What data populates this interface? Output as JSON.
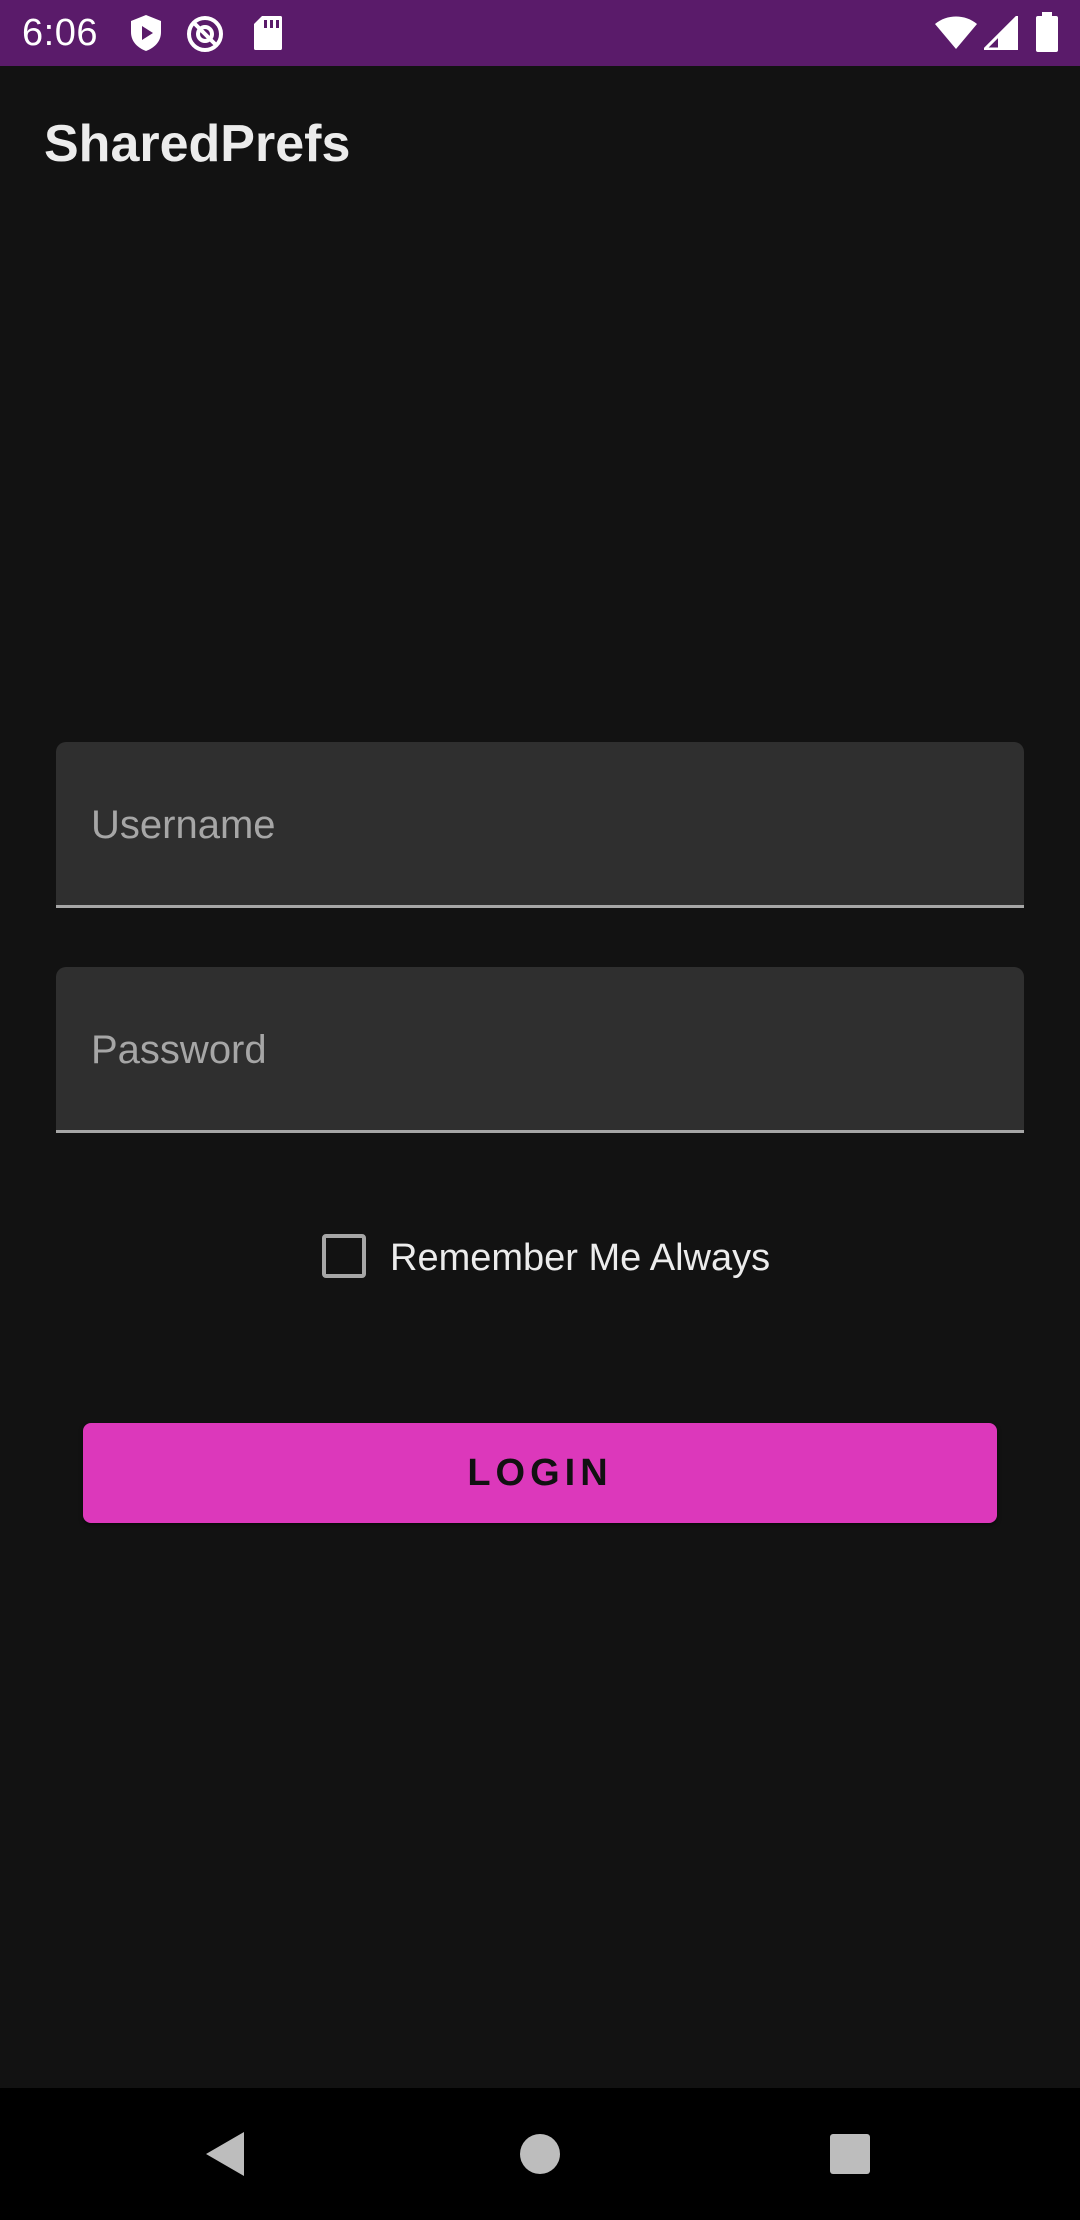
{
  "status_bar": {
    "time": "6:06",
    "icons": [
      "shield-play-icon",
      "at-sign-icon",
      "sd-card-icon",
      "wifi-icon",
      "cell-signal-icon",
      "battery-icon"
    ],
    "background_color": "#5a1b6a"
  },
  "app_bar": {
    "title": "SharedPrefs"
  },
  "form": {
    "username_placeholder": "Username",
    "username_value": "",
    "password_placeholder": "Password",
    "password_value": "",
    "remember_label": "Remember Me Always",
    "remember_checked": false,
    "login_label": "LOGIN"
  },
  "nav_bar": {
    "icons": [
      "back-icon",
      "home-icon",
      "recents-icon"
    ]
  },
  "colors": {
    "accent": "#dc38bb",
    "background": "#121212",
    "field_background": "#2f2f2f"
  }
}
